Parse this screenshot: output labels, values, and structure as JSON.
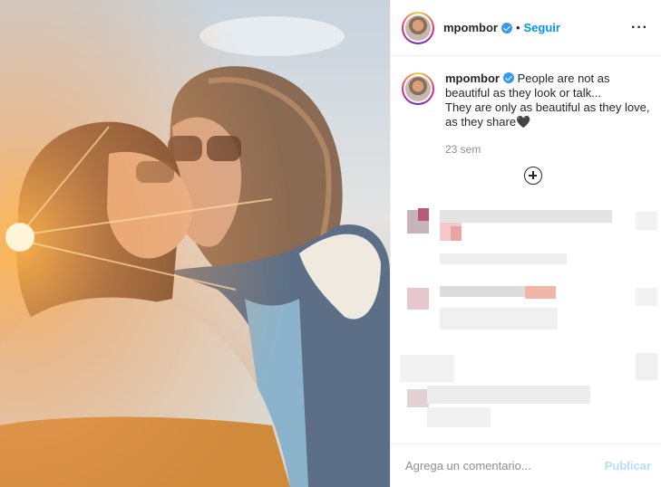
{
  "post": {
    "username": "mpombor",
    "follow_label": "Seguir",
    "more_icon": "···",
    "caption_line1": "People are not as",
    "caption_line2": "beautiful as they look or talk...",
    "caption_line3": "They are only as beautiful as they love,",
    "caption_line4": "as they share",
    "caption_emoji": "🖤",
    "time": "23 sem"
  },
  "footer": {
    "placeholder": "Agrega un comentario...",
    "publish_label": "Publicar"
  },
  "icons": [
    "verified-badge-icon",
    "more-options-icon",
    "load-more-comments-icon"
  ],
  "colors": {
    "accent": "#0095f6",
    "verified": "#3897f0",
    "publish_disabled": "#b2dffc",
    "muted": "#8e8e8e"
  }
}
